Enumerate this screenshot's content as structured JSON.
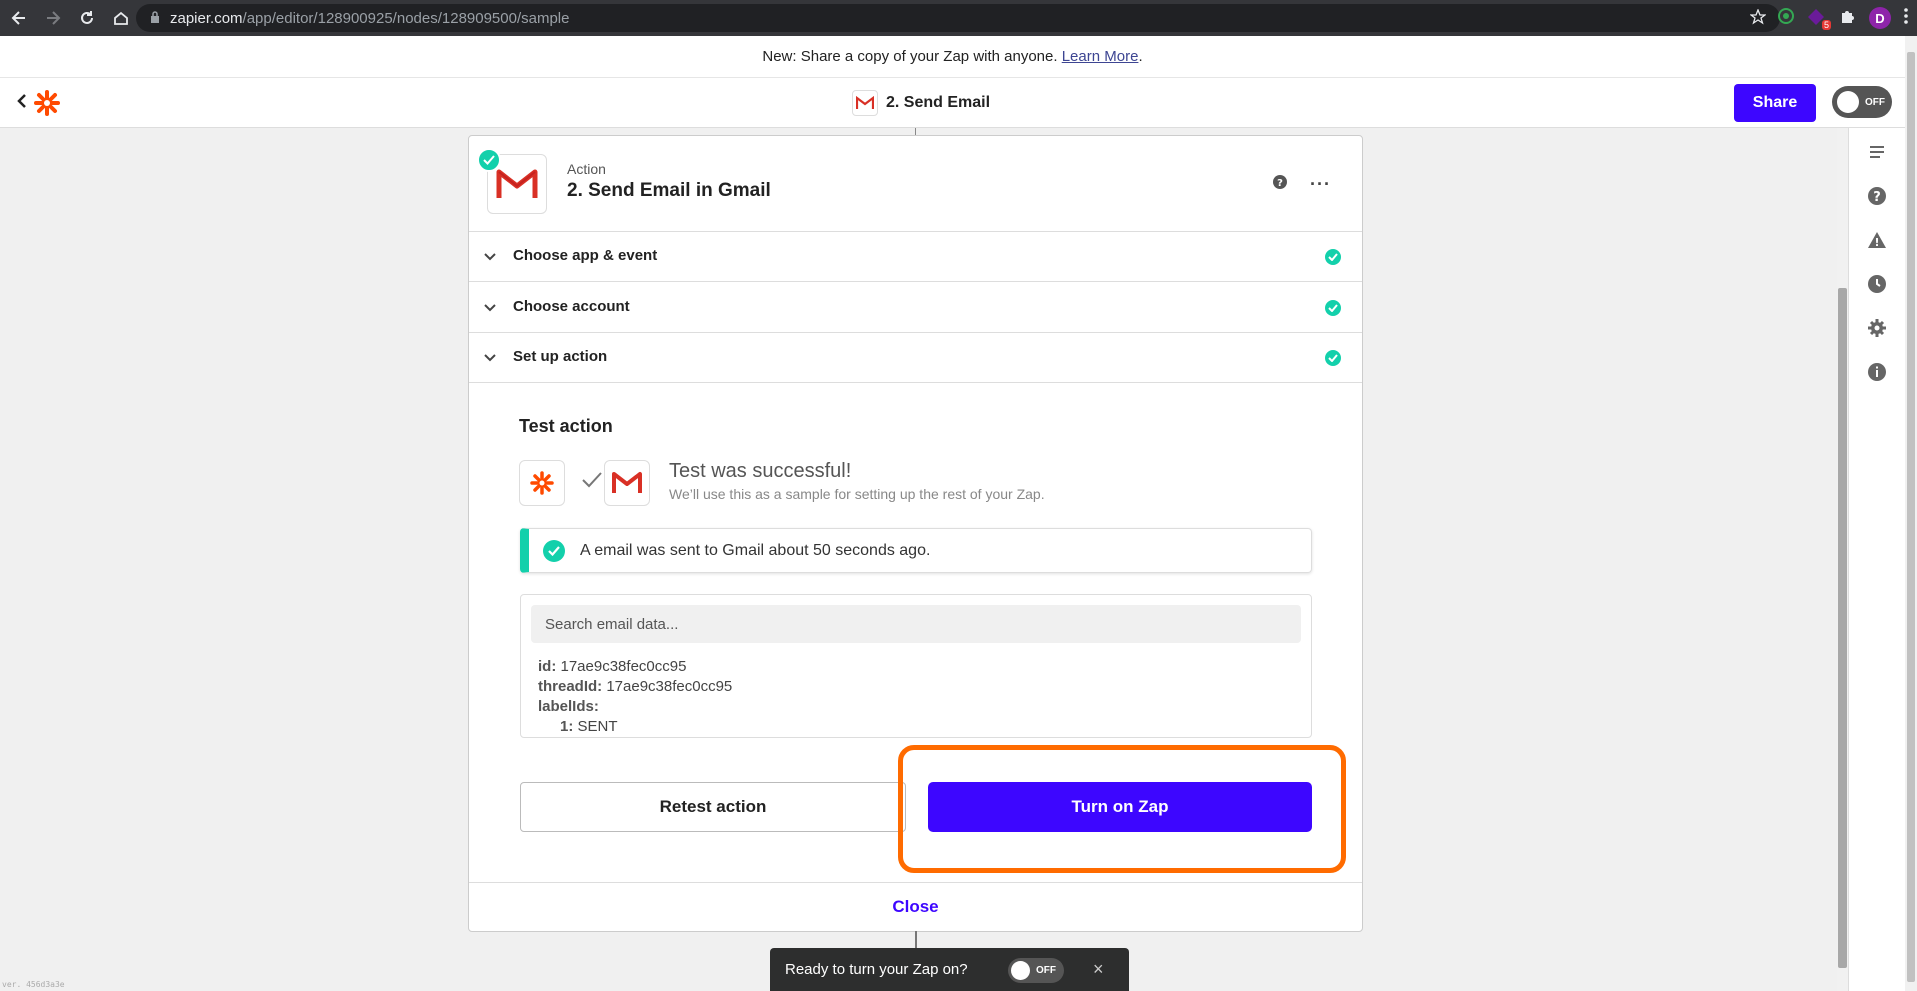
{
  "browser": {
    "url_host": "zapier.com",
    "url_path": "/app/editor/128900925/nodes/128909500/sample",
    "ext_badge": "5",
    "profile_initial": "D"
  },
  "announcement": {
    "text": "New: Share a copy of your Zap with anyone.",
    "link": "Learn More",
    "suffix": "."
  },
  "topbar": {
    "zap_title": "2. Send Email",
    "share_label": "Share",
    "toggle_label": "OFF"
  },
  "step": {
    "type_label": "Action",
    "title": "2. Send Email in Gmail",
    "more_label": "···"
  },
  "accordion": [
    {
      "label": "Choose app & event"
    },
    {
      "label": "Choose account"
    },
    {
      "label": "Set up action"
    }
  ],
  "test": {
    "title": "Test action",
    "success_title": "Test was successful!",
    "success_sub": "We’ll use this as a sample for setting up the rest of your Zap.",
    "alert": "A email was sent to Gmail about 50 seconds ago.",
    "search_placeholder": "Search email data...",
    "fields": {
      "id_key": "id:",
      "id_val": "17ae9c38fec0cc95",
      "thread_key": "threadId:",
      "thread_val": "17ae9c38fec0cc95",
      "labels_key": "labelIds:",
      "label1_key": "1:",
      "label1_val": "SENT"
    },
    "retest_label": "Retest action",
    "turnon_label": "Turn on Zap"
  },
  "footer": {
    "close_label": "Close"
  },
  "toast": {
    "text": "Ready to turn your Zap on?",
    "toggle_label": "OFF",
    "close_label": "×"
  },
  "version": "ver. 456d3a3e",
  "colors": {
    "accent": "#3d06ff",
    "success": "#13d0ab",
    "highlight": "#ff6b00"
  }
}
